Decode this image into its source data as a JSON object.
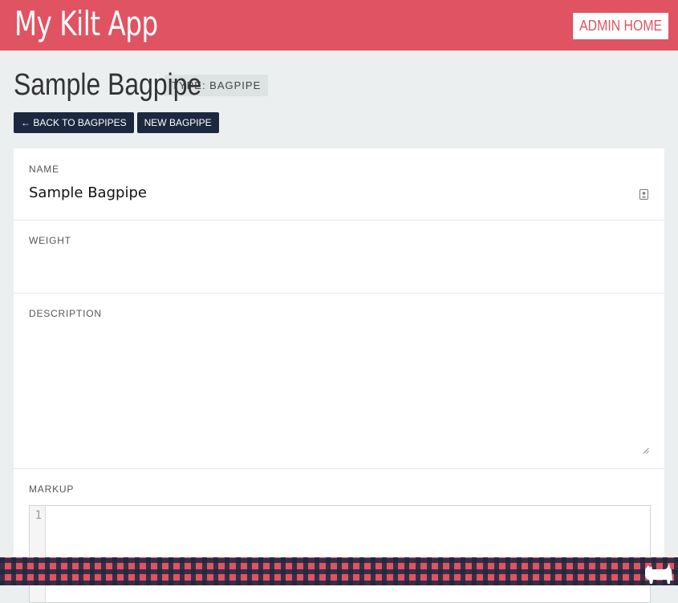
{
  "header": {
    "app_title": "My Kilt App",
    "admin_home_label": "ADMIN HOME"
  },
  "page": {
    "title": "Sample Bagpipe",
    "type_badge": "TYPE: BAGPIPE"
  },
  "actions": {
    "back_label": "← BACK TO BAGPIPES",
    "new_label": "NEW BAGPIPE"
  },
  "form": {
    "name_label": "NAME",
    "name_value": "Sample Bagpipe",
    "weight_label": "WEIGHT",
    "weight_value": "",
    "description_label": "DESCRIPTION",
    "description_value": "",
    "markup_label": "MARKUP",
    "markup_line_numbers": [
      "1"
    ]
  },
  "icons": {
    "name_field_icon": "contact-card-icon",
    "footer_mascot": "scottie-dog-icon"
  },
  "colors": {
    "brand_red": "#e05362",
    "navy": "#1c2840",
    "page_bg": "#ebeff0"
  }
}
